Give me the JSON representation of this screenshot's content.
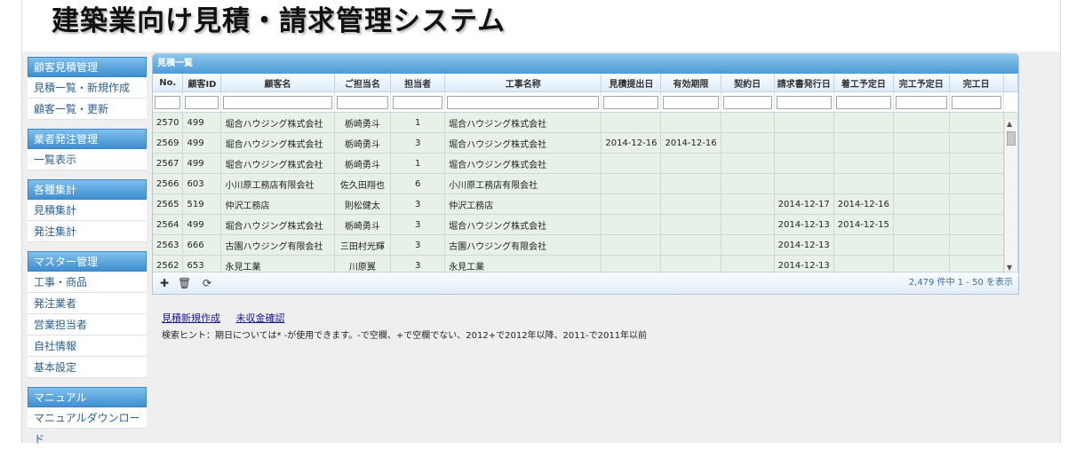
{
  "app_title": "建築業向け見積・請求管理システム",
  "sidebar": [
    {
      "header": "顧客見積管理",
      "items": [
        "見積一覧・新規作成",
        "顧客一覧・更新"
      ]
    },
    {
      "header": "業者発注管理",
      "items": [
        "一覧表示"
      ]
    },
    {
      "header": "各種集計",
      "items": [
        "見積集計",
        "発注集計"
      ]
    },
    {
      "header": "マスター管理",
      "items": [
        "工事・商品",
        "発注業者",
        "営業担当者",
        "自社情報",
        "基本設定"
      ]
    },
    {
      "header": "マニュアル",
      "items": [
        "マニュアルダウンロード"
      ]
    }
  ],
  "grid": {
    "caption": "見積一覧",
    "columns": [
      "No.",
      "顧客ID",
      "顧客名",
      "ご担当名",
      "担当者",
      "工事名称",
      "見積提出日",
      "有効期限",
      "契約日",
      "請求書発行日",
      "着工予定日",
      "完工予定日",
      "完工日"
    ],
    "rows": [
      [
        "2570",
        "499",
        "堀合ハウジング株式会社",
        "栃崎勇斗",
        "1",
        "堀合ハウジング株式会社",
        "",
        "",
        "",
        "",
        "",
        "",
        ""
      ],
      [
        "2569",
        "499",
        "堀合ハウジング株式会社",
        "栃崎勇斗",
        "3",
        "堀合ハウジング株式会社",
        "2014-12-16",
        "2014-12-16",
        "",
        "",
        "",
        "",
        ""
      ],
      [
        "2567",
        "499",
        "堀合ハウジング株式会社",
        "栃崎勇斗",
        "1",
        "堀合ハウジング株式会社",
        "",
        "",
        "",
        "",
        "",
        "",
        ""
      ],
      [
        "2566",
        "603",
        "小川原工務店有限会社",
        "佐久田翔也",
        "6",
        "小川原工務店有限会社",
        "",
        "",
        "",
        "",
        "",
        "",
        ""
      ],
      [
        "2565",
        "519",
        "仲沢工務店",
        "則松健太",
        "3",
        "仲沢工務店",
        "",
        "",
        "",
        "2014-12-17",
        "2014-12-16",
        "",
        ""
      ],
      [
        "2564",
        "499",
        "堀合ハウジング株式会社",
        "栃崎勇斗",
        "3",
        "堀合ハウジング株式会社",
        "",
        "",
        "",
        "2014-12-13",
        "2014-12-15",
        "",
        ""
      ],
      [
        "2563",
        "666",
        "古園ハウジング有限会社",
        "三田村光輝",
        "3",
        "古園ハウジング有限会社",
        "",
        "",
        "",
        "2014-12-13",
        "",
        "",
        ""
      ],
      [
        "2562",
        "653",
        "永見工業",
        "川原翼",
        "3",
        "永見工業",
        "",
        "",
        "",
        "2014-12-13",
        "",
        "",
        ""
      ]
    ],
    "pager_text": "2,479 件中 1 - 50 を表示",
    "toolbar_icons": [
      "add-icon",
      "delete-icon",
      "refresh-icon"
    ]
  },
  "links": [
    "見積新規作成",
    "未収金確認"
  ],
  "hint": "検索ヒント：期日については* -が使用できます。-で空欄、+で空欄でない、2012+で2012年以降、2011-で2011年以前"
}
